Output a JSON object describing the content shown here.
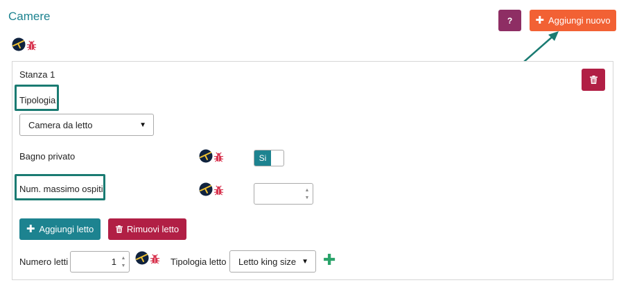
{
  "page": {
    "title": "Camere"
  },
  "header": {
    "help_label": "?",
    "add_new_label": "Aggiungi nuovo"
  },
  "room": {
    "title": "Stanza 1",
    "type_label": "Tipologia",
    "type_value": "Camera da letto",
    "private_bath_label": "Bagno privato",
    "private_bath_value": "Si",
    "max_guests_label": "Num. massimo ospiti",
    "max_guests_value": ""
  },
  "beds": {
    "add_label": "Aggiungi letto",
    "remove_label": "Rimuovi letto",
    "count_label": "Numero letti",
    "count_value": "1",
    "type_label": "Tipologia letto",
    "type_value": "Letto king size"
  },
  "colors": {
    "teal": "#1d8390",
    "orange": "#f26134",
    "purple": "#8e2e64",
    "crimson": "#b11f45",
    "annotation": "#1a7b72",
    "green": "#2aa36a"
  },
  "icons": [
    "plus-icon",
    "help-icon",
    "globe-icon",
    "bug-icon",
    "trash-icon",
    "caret-down-icon",
    "annotation-arrow-icon"
  ]
}
